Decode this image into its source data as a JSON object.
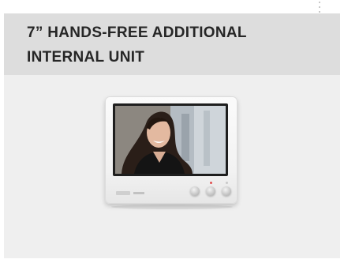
{
  "card": {
    "title_line1": "7” HANDS-FREE ADDITIONAL",
    "title_line2": "INTERNAL UNIT"
  },
  "icons": {
    "menu": "more-vertical-icon"
  }
}
